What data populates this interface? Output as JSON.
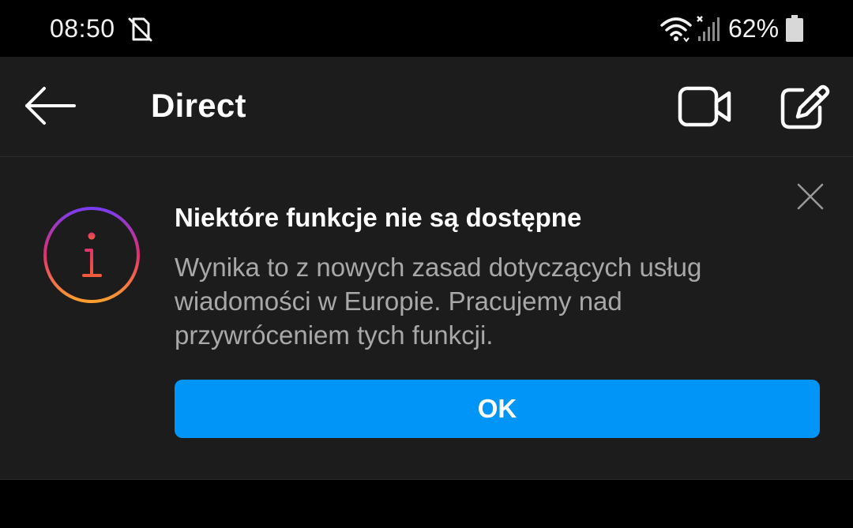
{
  "status_bar": {
    "time": "08:50",
    "battery_percent": "62%",
    "icons": [
      "no-sim-icon",
      "wifi-icon",
      "signal-icon",
      "battery-icon"
    ]
  },
  "header": {
    "title": "Direct",
    "icons": [
      "arrow-left-icon",
      "video-camera-icon",
      "compose-icon"
    ]
  },
  "banner": {
    "title": "Niektóre funkcje nie są dostępne",
    "body": "Wynika to z nowych zasad dotyczących usług wiadomości w Europie. Pracujemy nad przywróceniem tych funkcji.",
    "ok_label": "OK",
    "icons": [
      "info-icon",
      "close-icon"
    ]
  },
  "colors": {
    "background": "#000000",
    "surface": "#1c1c1c",
    "text_primary": "#ffffff",
    "text_secondary": "#a8a8a8",
    "accent": "#0095f6",
    "gradient": [
      "#7a3cf0",
      "#e1306c",
      "#fd9e2e"
    ]
  }
}
